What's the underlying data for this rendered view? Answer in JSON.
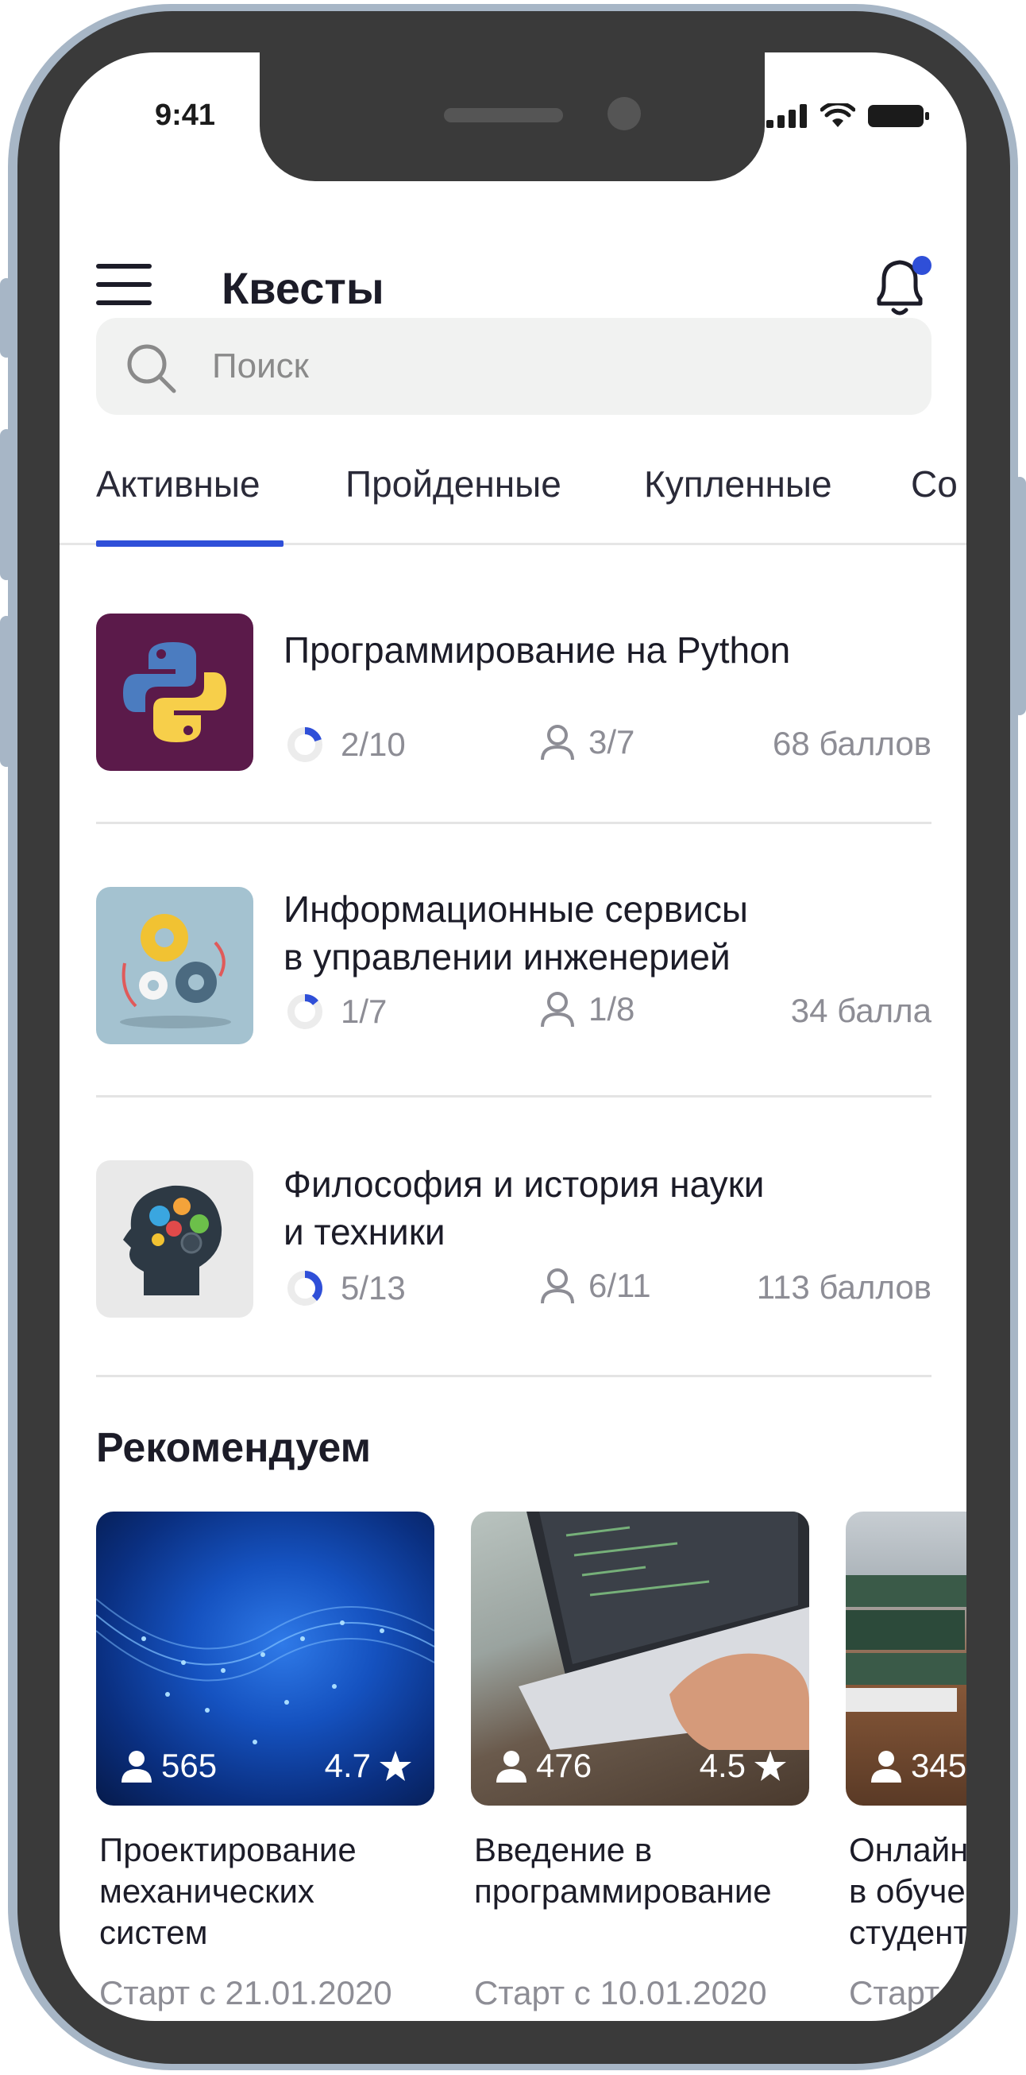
{
  "status": {
    "time": "9:41"
  },
  "header": {
    "title": "Квесты"
  },
  "search": {
    "placeholder": "Поиск"
  },
  "tabs": [
    {
      "label": "Активные",
      "active": true
    },
    {
      "label": "Пройденные",
      "active": false
    },
    {
      "label": "Купленные",
      "active": false
    },
    {
      "label": "Со",
      "active": false
    }
  ],
  "quests": [
    {
      "title": "Программирование на Python",
      "progress": "2/10",
      "progress_fraction": 0.2,
      "users": "3/7",
      "points": "68 баллов",
      "icon": "python-logo-icon"
    },
    {
      "title_line1": "Информационные сервисы",
      "title_line2": "в управлении инженерией",
      "progress": "1/7",
      "progress_fraction": 0.14,
      "users": "1/8",
      "points": "34 балла",
      "icon": "gears-icon"
    },
    {
      "title_line1": "Философия и история науки",
      "title_line2": "и техники",
      "progress": "5/13",
      "progress_fraction": 0.38,
      "users": "6/11",
      "points": "113 баллов",
      "icon": "head-gears-icon"
    }
  ],
  "recommend": {
    "title": "Рекомендуем",
    "items": [
      {
        "users": "565",
        "rating": "4.7",
        "title_lines": [
          "Проектирование",
          "механических",
          "систем"
        ],
        "date": "Старт с 21.01.2020"
      },
      {
        "users": "476",
        "rating": "4.5",
        "title_lines": [
          "Введение в",
          "программирование"
        ],
        "date": "Старт с 10.01.2020"
      },
      {
        "users": "345",
        "rating": "",
        "title_lines": [
          "Онлайн",
          "в обуче",
          "студент"
        ],
        "date": "Старт с"
      }
    ]
  },
  "colors": {
    "accent": "#2f4fd8",
    "notification_dot": "#2f4fd8"
  }
}
